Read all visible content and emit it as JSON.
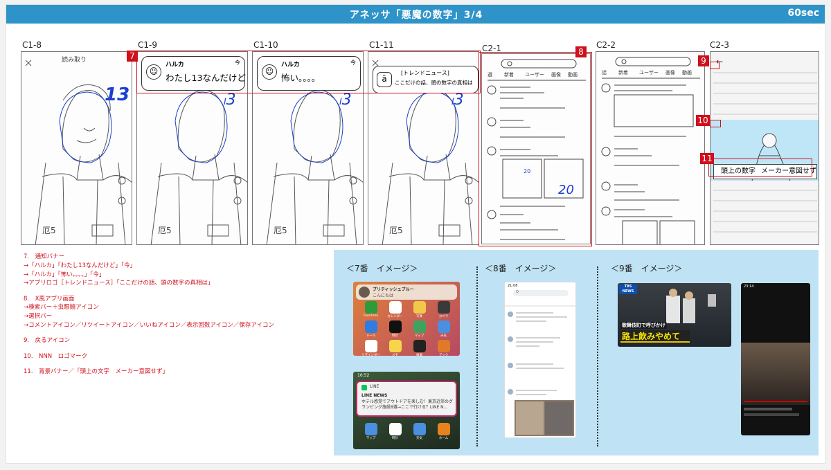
{
  "header": {
    "title": "アネッサ「悪魔の数字」3/4",
    "duration": "60sec"
  },
  "frames": [
    {
      "label": "C1-8",
      "top_text": "読み取り"
    },
    {
      "label": "C1-9",
      "name": "ハルカ",
      "message": "わたし13なんだけど",
      "time": "今"
    },
    {
      "label": "C1-10",
      "name": "ハルカ",
      "message": "怖い。。。。",
      "time": "今"
    },
    {
      "label": "C1-11",
      "app": "[トレンドニュース]",
      "message": "ここだけの話、頭の数字の真相は"
    },
    {
      "label": "C2-1"
    },
    {
      "label": "C2-2"
    },
    {
      "label": "C2-3",
      "banner_left": "頭上の数字",
      "banner_right": "メーカー意図せず"
    }
  ],
  "sketch_numbers": {
    "head": "13",
    "photo": "20"
  },
  "tags": [
    "7",
    "8",
    "9",
    "10",
    "11"
  ],
  "notes": {
    "s7": [
      "7.　通知バナー",
      "→「ハルカ」「わたし13なんだけど」「今」",
      "→「ハルカ」「怖い。。。。」「今」",
      "→アプリロゴ［トレンドニュース］「ここだけの話、頭の数字の真相は」"
    ],
    "s8": [
      "8.　X風アプリ画面",
      "→検索バー＋虫眼鏡アイコン",
      "→選択バー",
      "→コメントアイコン／リツイートアイコン／いいねアイコン／表示回数アイコン／保存アイコン"
    ],
    "s9": "9.　戻るアイコン",
    "s10": "10.　NNN　ロゴマーク",
    "s11": "11.　背景バナー／「頭上の文字　メーカー意図せず」"
  },
  "images": {
    "t7": "＜7番　イメージ＞",
    "t8": "＜8番　イメージ＞",
    "t9": "＜9番　イメージ＞",
    "i7a_title": "ブリティッシュブルー",
    "i7a_sub": "こんにちは",
    "i7a_apps": [
      "FaceTime",
      "カレンダー",
      "写真",
      "カメラ",
      "メール",
      "時計",
      "マップ",
      "天気",
      "リマインダー",
      "メモ",
      "株価",
      "ブック"
    ],
    "i7b_time": "16:52",
    "i7b_app": "LINE",
    "i7b_title": "LINE NEWS",
    "i7b_body": "ホテル感覚でアウトドアを楽しむ！東京近郊のグランピング施設8選→ここで行ける？LINE N...",
    "i7b_dock": [
      "マップ",
      "時計",
      "天気",
      "ホーム"
    ],
    "i8_time": "21:08",
    "i8_search": "Q",
    "i9a_logo": "TBS NEWS",
    "i9a_caption1": "歌舞伎町で呼びかけ",
    "i9a_caption2": "路上飲みやめて",
    "i9b_time": "23:14"
  },
  "colors": {
    "accent": "#2e93c8",
    "red": "#d0101c",
    "panel": "#bfe2f4",
    "sketch_blue": "#1a3fd1"
  }
}
